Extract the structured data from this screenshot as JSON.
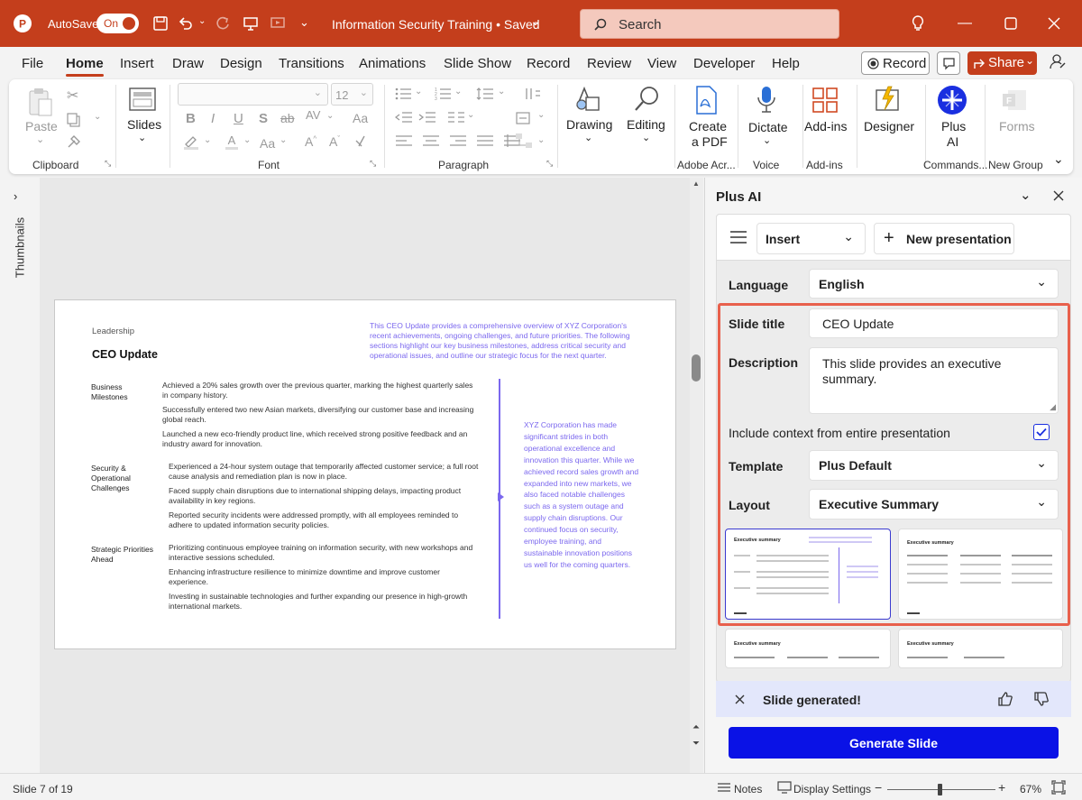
{
  "titlebar": {
    "autosave_label": "AutoSave",
    "autosave_state": "On",
    "document_title": "Information Security Training • Saved",
    "search_placeholder": "Search"
  },
  "menu": {
    "tabs": [
      "File",
      "Home",
      "Insert",
      "Draw",
      "Design",
      "Transitions",
      "Animations",
      "Slide Show",
      "Record",
      "Review",
      "View",
      "Developer",
      "Help"
    ],
    "record_button": "Record",
    "share_button": "Share"
  },
  "ribbon": {
    "paste": "Paste",
    "clipboard_group": "Clipboard",
    "slides": "Slides",
    "font_size": "12",
    "font_group": "Font",
    "paragraph_group": "Paragraph",
    "drawing": "Drawing",
    "editing": "Editing",
    "create_pdf_line1": "Create",
    "create_pdf_line2": "a PDF",
    "adobe_group": "Adobe Acr...",
    "dictate": "Dictate",
    "voice_group": "Voice",
    "addins": "Add-ins",
    "addins_group": "Add-ins",
    "designer": "Designer",
    "plusai_line1": "Plus",
    "plusai_line2": "AI",
    "commands_group": "Commands...",
    "forms": "Forms",
    "new_group": "New Group"
  },
  "left": {
    "thumbnails": "Thumbnails"
  },
  "slide": {
    "section": "Leadership",
    "title": "CEO Update",
    "intro": "This CEO Update provides a comprehensive overview of XYZ Corporation's recent achievements, ongoing challenges, and future priorities. The following sections highlight our key business milestones, address critical security and operational issues, and outline our strategic focus for the next quarter.",
    "groups": [
      {
        "heading": "Business Milestones",
        "items": [
          "Achieved a 20% sales growth over the previous quarter, marking the highest quarterly sales in company history.",
          "Successfully entered two new Asian markets, diversifying our customer base and increasing global reach.",
          "Launched a new eco-friendly product line, which received strong positive feedback and an industry award for innovation."
        ]
      },
      {
        "heading": "Security & Operational Challenges",
        "items": [
          "Experienced a 24-hour system outage that temporarily affected customer service; a full root cause analysis and remediation plan is now in place.",
          "Faced supply chain disruptions due to international shipping delays, impacting product availability in key regions.",
          "Reported security incidents were addressed promptly, with all employees reminded to adhere to updated information security policies."
        ]
      },
      {
        "heading": "Strategic Priorities Ahead",
        "items": [
          "Prioritizing continuous employee training on information security, with new workshops and interactive sessions scheduled.",
          "Enhancing infrastructure resilience to minimize downtime and improve customer experience.",
          "Investing in sustainable technologies and further expanding our presence in high-growth international markets."
        ]
      }
    ],
    "summary": "XYZ Corporation has made significant strides in both operational excellence and innovation this quarter. While we achieved record sales growth and expanded into new markets, we also faced notable challenges such as a system outage and supply chain disruptions. Our continued focus on security, employee training, and sustainable innovation positions us well for the coming quarters."
  },
  "panel": {
    "title": "Plus AI",
    "mode_select": "Insert",
    "new_presentation": "New presentation",
    "language_label": "Language",
    "language_value": "English",
    "slide_title_label": "Slide title",
    "slide_title_value": "CEO Update",
    "description_label": "Description",
    "description_value": "This slide provides an executive summary.",
    "context_label": "Include context from entire presentation",
    "context_checked": true,
    "template_label": "Template",
    "template_value": "Plus Default",
    "layout_label": "Layout",
    "layout_value": "Executive Summary",
    "layout_thumbnail_title": "Executive summary",
    "generated_msg": "Slide generated!",
    "generate_button": "Generate Slide"
  },
  "status": {
    "slide_counter": "Slide 7 of 19",
    "notes": "Notes",
    "display_settings": "Display Settings",
    "zoom": "67%",
    "zoom_minus": "−",
    "zoom_plus": "+",
    "zoom_level": 0.48
  },
  "colors": {
    "accent": "#c43e1c",
    "primary_button": "#0a12e6",
    "purple": "#7b68ee",
    "highlight_border": "#e8604c"
  }
}
